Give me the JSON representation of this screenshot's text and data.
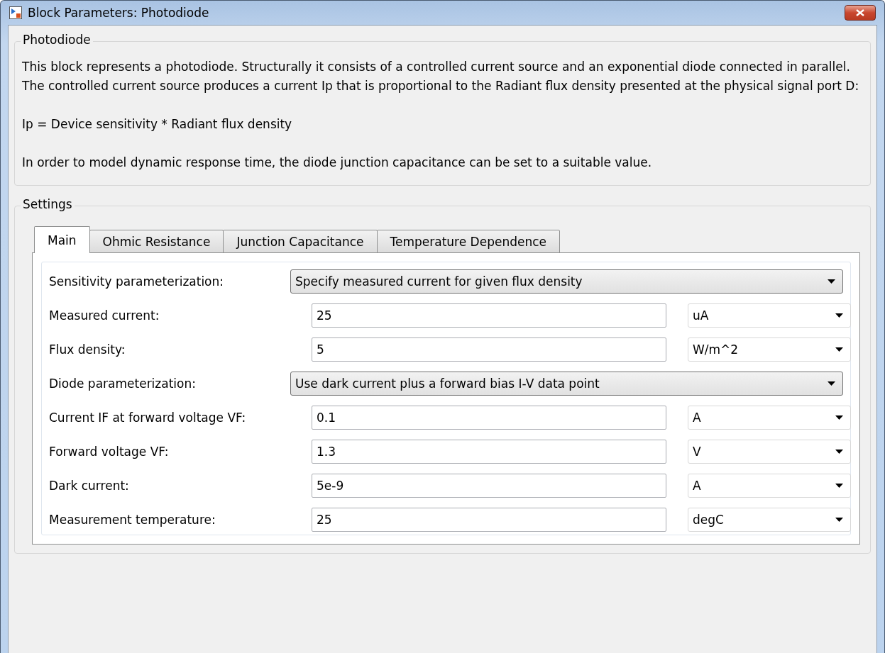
{
  "window": {
    "title": "Block Parameters: Photodiode"
  },
  "description": {
    "title": "Photodiode",
    "paragraphs": [
      "This block represents a photodiode. Structurally it consists of a controlled current source and an exponential diode connected in parallel. The controlled current source produces a current Ip that is proportional to the Radiant flux density presented at the physical signal port D:",
      "Ip = Device sensitivity * Radiant flux density",
      "In order to model dynamic response time, the diode junction capacitance can be set to a suitable value."
    ]
  },
  "settings": {
    "title": "Settings",
    "tabs": [
      {
        "label": "Main",
        "selected": true
      },
      {
        "label": "Ohmic Resistance",
        "selected": false
      },
      {
        "label": "Junction Capacitance",
        "selected": false
      },
      {
        "label": "Temperature Dependence",
        "selected": false
      }
    ],
    "rows": [
      {
        "kind": "choice",
        "label": "Sensitivity parameterization:",
        "value": "Specify measured current for given flux density"
      },
      {
        "kind": "value",
        "label": "Measured current:",
        "value": "25",
        "unit": "uA"
      },
      {
        "kind": "value",
        "label": "Flux density:",
        "value": "5",
        "unit": "W/m^2"
      },
      {
        "kind": "choice",
        "label": "Diode parameterization:",
        "value": "Use dark current plus a forward bias I-V data point"
      },
      {
        "kind": "value",
        "label": "Current IF at forward voltage VF:",
        "value": "0.1",
        "unit": "A"
      },
      {
        "kind": "value",
        "label": "Forward voltage VF:",
        "value": "1.3",
        "unit": "V"
      },
      {
        "kind": "value",
        "label": "Dark current:",
        "value": "5e-9",
        "unit": "A"
      },
      {
        "kind": "value",
        "label": "Measurement temperature:",
        "value": "25",
        "unit": "degC"
      }
    ]
  }
}
